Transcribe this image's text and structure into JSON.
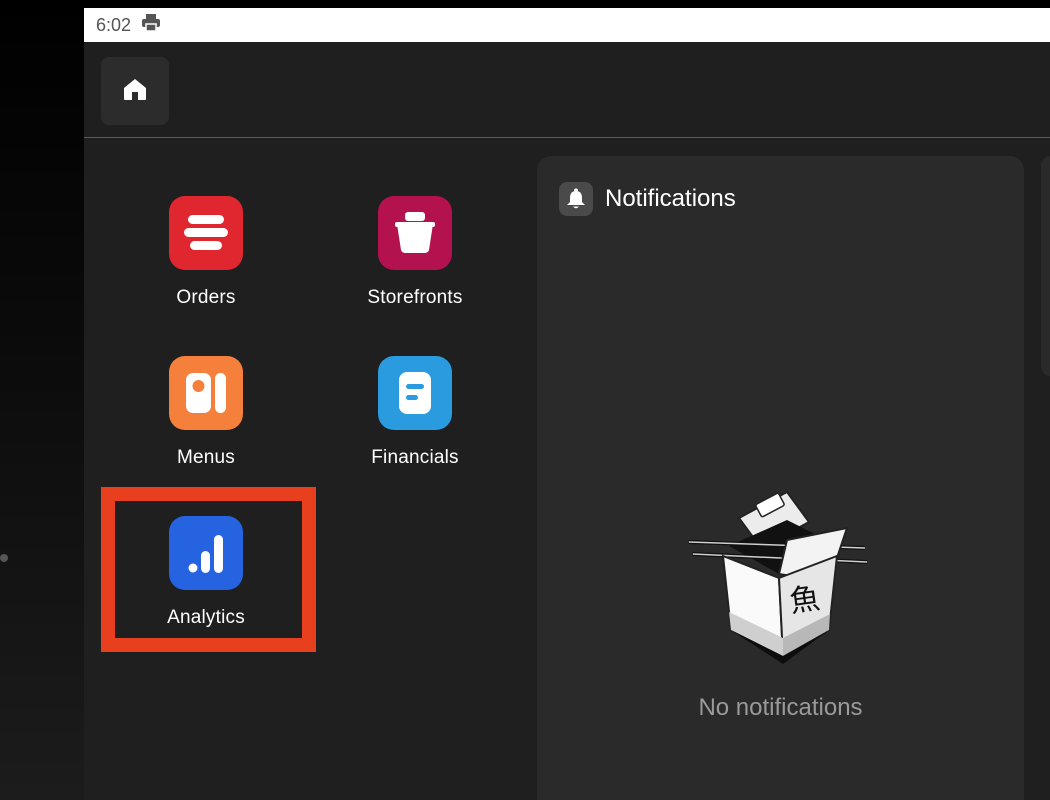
{
  "status_bar": {
    "time": "6:02",
    "icon": "printer-icon"
  },
  "header": {
    "home_icon": "home-icon"
  },
  "tiles": [
    {
      "label": "Orders",
      "icon": "orders-icon",
      "color": "#e0262f"
    },
    {
      "label": "Storefronts",
      "icon": "storefronts-icon",
      "color": "#b3124e"
    },
    {
      "label": "Menus",
      "icon": "menus-icon",
      "color": "#f5803c"
    },
    {
      "label": "Financials",
      "icon": "financials-icon",
      "color": "#2b9be0"
    },
    {
      "label": "Analytics",
      "icon": "analytics-icon",
      "color": "#2563e0"
    }
  ],
  "highlight_color": "#e8401f",
  "notifications": {
    "title": "Notifications",
    "icon": "bell-icon",
    "empty_text": "No notifications",
    "illustration_glyph": "魚"
  }
}
